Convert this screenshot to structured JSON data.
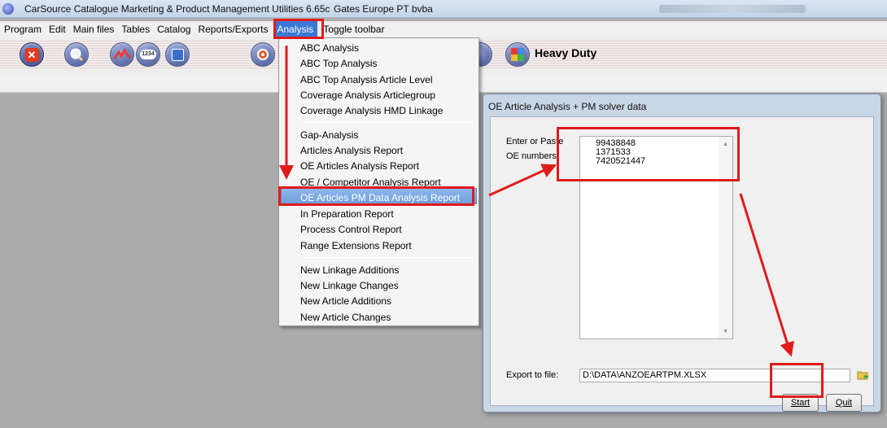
{
  "window": {
    "title": "CarSource Catalogue Marketing & Product Management Utilities  6.65c",
    "company": "Gates Europe PT bvba"
  },
  "menubar": {
    "items": [
      "Program",
      "Edit",
      "Main files",
      "Tables",
      "Catalog",
      "Reports/Exports",
      "Analysis",
      "Toggle toolbar"
    ],
    "active": "Analysis"
  },
  "toolbar": {
    "heavy_duty_label": "Heavy Duty",
    "num_button_text": "1234",
    "icons": [
      "close-icon",
      "search-icon",
      "chart-icon",
      "number-icon",
      "tools-icon",
      "settings-icon",
      "puzzle-icon"
    ]
  },
  "analysis_menu": {
    "group1": [
      "ABC Analysis",
      "ABC Top Analysis",
      "ABC Top Analysis Article Level",
      "Coverage Analysis Articlegroup",
      "Coverage Analysis HMD Linkage"
    ],
    "group2": [
      "Gap-Analysis",
      "Articles Analysis Report",
      "OE Articles Analysis Report",
      "OE / Competitor Analysis Report",
      "OE Articles PM Data Analysis Report",
      "In Preparation Report",
      "Process Control Report",
      "Range Extensions Report"
    ],
    "group3": [
      "New Linkage Additions",
      "New Linkage Changes",
      "New Article Additions",
      "New Article Changes"
    ],
    "selected": "OE Articles PM Data Analysis Report"
  },
  "dialog": {
    "title": "OE Article Analysis + PM solver data",
    "enter_label_line1": "Enter or Paste",
    "enter_label_line2": "OE numbers:",
    "oe_numbers": [
      "99438848",
      "1371533",
      "7420521447"
    ],
    "export_label": "Export to file:",
    "export_path": "D:\\DATA\\ANZOEARTPM.XLSX",
    "start_label": "Start",
    "quit_label": "Quit"
  },
  "colors": {
    "highlight": "#e01b1b",
    "menu_selected": "#3a78d6",
    "workspace": "#ababab"
  }
}
